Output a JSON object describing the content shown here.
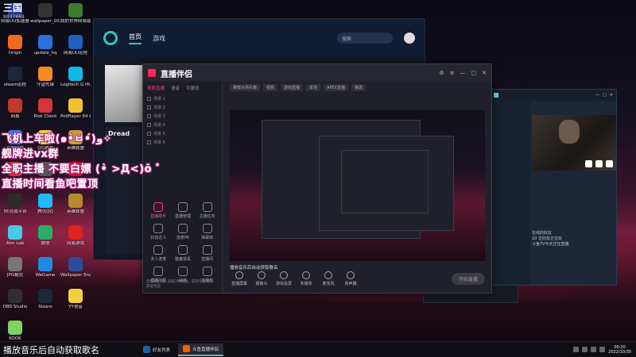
{
  "top_logo": {
    "title": "三国",
    "sub": "9937469"
  },
  "desktop_icons": [
    {
      "label": "网易UU加速器",
      "color": "#1e3a8a"
    },
    {
      "label": "wallpaper_2022052...",
      "color": "#333"
    },
    {
      "label": "我的世界网易版平台",
      "color": "#3b7d2c"
    },
    {
      "label": "Origin",
      "color": "#f26b1d"
    },
    {
      "label": "update_hq",
      "color": "#2a6fdb"
    },
    {
      "label": "网易UU远程",
      "color": "#1f5fbf"
    },
    {
      "label": "steam远程",
      "color": "#1b2838"
    },
    {
      "label": "守望先锋",
      "color": "#f58a1f"
    },
    {
      "label": "Logitech G HUB",
      "color": "#11b7e6"
    },
    {
      "label": "网易",
      "color": "#c0392b"
    },
    {
      "label": "Riot Client",
      "color": "#d13639"
    },
    {
      "label": "PotPlayer 64 bit",
      "color": "#f2c12e"
    },
    {
      "label": "百度网盘",
      "color": "#2a7fff"
    },
    {
      "label": "QQ游戏",
      "color": "#f7c948"
    },
    {
      "label": "英雄联盟",
      "color": "#c89b3c"
    },
    {
      "label": "Apex",
      "color": "#d3302f"
    },
    {
      "label": "游戏",
      "color": "#555"
    },
    {
      "label": "网易云音乐",
      "color": "#e60026"
    },
    {
      "label": "5E对战平台",
      "color": "#2b2b2b"
    },
    {
      "label": "腾讯QQ",
      "color": "#1ebafc"
    },
    {
      "label": "英雄联盟",
      "color": "#b5892d"
    },
    {
      "label": "Aim Lab",
      "color": "#4bc8e8"
    },
    {
      "label": "微信",
      "color": "#2aae67"
    },
    {
      "label": "网易游戏",
      "color": "#d22"
    },
    {
      "label": "JPG格式",
      "color": "#777"
    },
    {
      "label": "WeGame",
      "color": "#1f8be0"
    },
    {
      "label": "Wallpaper Engine",
      "color": "#2d4b9a"
    },
    {
      "label": "OBS Studio",
      "color": "#302e31"
    },
    {
      "label": "Steam",
      "color": "#1b2838"
    },
    {
      "label": "YY语音",
      "color": "#f4d03f"
    },
    {
      "label": "KOOK",
      "color": "#7dd35f"
    }
  ],
  "back_window": {
    "tab_home": "首页",
    "tab_games": "游戏",
    "search": "搜索",
    "title": "Dread"
  },
  "main_window": {
    "app_name": "直播伴侣",
    "left_tabs": [
      "视频直播",
      "语音",
      "可更改"
    ],
    "scenes": [
      "场景 1",
      "场景 2",
      "场景 3",
      "场景 4",
      "场景 5",
      "场景 6"
    ],
    "tools": [
      {
        "label": "直播助手",
        "active": true
      },
      {
        "label": "直播管理",
        "active": false
      },
      {
        "label": "主播任务",
        "active": false
      },
      {
        "label": "抖音达人",
        "active": false
      },
      {
        "label": "连麦PK",
        "active": false
      },
      {
        "label": "弹幕库",
        "active": false
      },
      {
        "label": "多人连麦",
        "active": false
      },
      {
        "label": "整蛊道具",
        "active": false
      },
      {
        "label": "直播间",
        "active": false
      },
      {
        "label": "直播下载",
        "active": false
      },
      {
        "label": "消息",
        "active": false
      },
      {
        "label": "主播商",
        "active": false
      }
    ],
    "bottom_note": "无限制主播，链接2种活动，获取专属特效，获取奖励",
    "center_tabs": [
      "推荐大师头像",
      "视频",
      "游戏直播",
      "本地",
      "APEX直播",
      "精选"
    ],
    "music_label": "播放音乐后自动获取歌名",
    "controls": [
      "直播屏幕",
      "摄像头",
      "游戏投屏",
      "多媒体",
      "麦克风",
      "扬声器"
    ],
    "live_button": "开始直播"
  },
  "right_window": {
    "friends_title": "好友",
    "friends_line1": "在线的好友",
    "friends_line2": "10 位好友正在玩",
    "friends_line3": "斗鱼TV今天正在直播"
  },
  "overlay_lines": [
    "飞机上车啦(๑•̀ㅂ•́)و✧",
    "舰牌进vx群",
    "全职主播 不要白嫖 (•̀ >Д<)ŏ ゜",
    "直播时间看鱼吧置顶"
  ],
  "taskbar": {
    "song": "播放音乐后自动获取歌名",
    "tasks": [
      {
        "label": "好友列表",
        "color": "#1b5fa8",
        "active": false
      },
      {
        "label": "斗鱼直播伴侣",
        "color": "#ff5a00",
        "active": true
      }
    ],
    "time": "00:20",
    "date": "2022/10/30"
  }
}
